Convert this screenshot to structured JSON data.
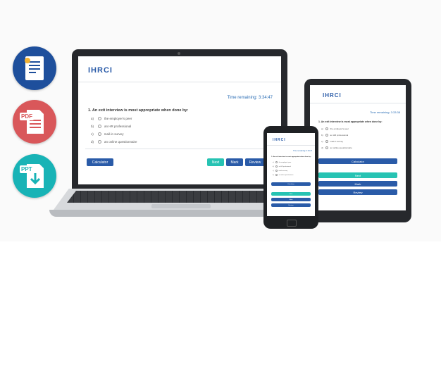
{
  "brand": {
    "logo": "IHRCI",
    "accent": "#2a5ba8",
    "teal": "#27c3b3"
  },
  "badges": [
    {
      "icon": "certificate-document-icon",
      "color": "#1e4f9c"
    },
    {
      "icon": "pdf-document-icon",
      "label": "PDF",
      "color": "#d9575a"
    },
    {
      "icon": "ppt-download-icon",
      "label": "PPT",
      "color": "#18b3b6"
    }
  ],
  "exam": {
    "timer": "Time remaining: 3:34:47",
    "tablet_timer": "Time remaining: 3:33:38",
    "question": "1. An exit interview is most appropriate when done by:",
    "options": [
      {
        "letter": "a)",
        "text": "the employer's peer"
      },
      {
        "letter": "b)",
        "text": "an HR professional"
      },
      {
        "letter": "c)",
        "text": "mail-in survey"
      },
      {
        "letter": "d)",
        "text": "an online questionnaire"
      }
    ],
    "buttons": {
      "calculator": "Calculator",
      "next": "Next",
      "mark": "Mark",
      "review": "Review"
    }
  }
}
